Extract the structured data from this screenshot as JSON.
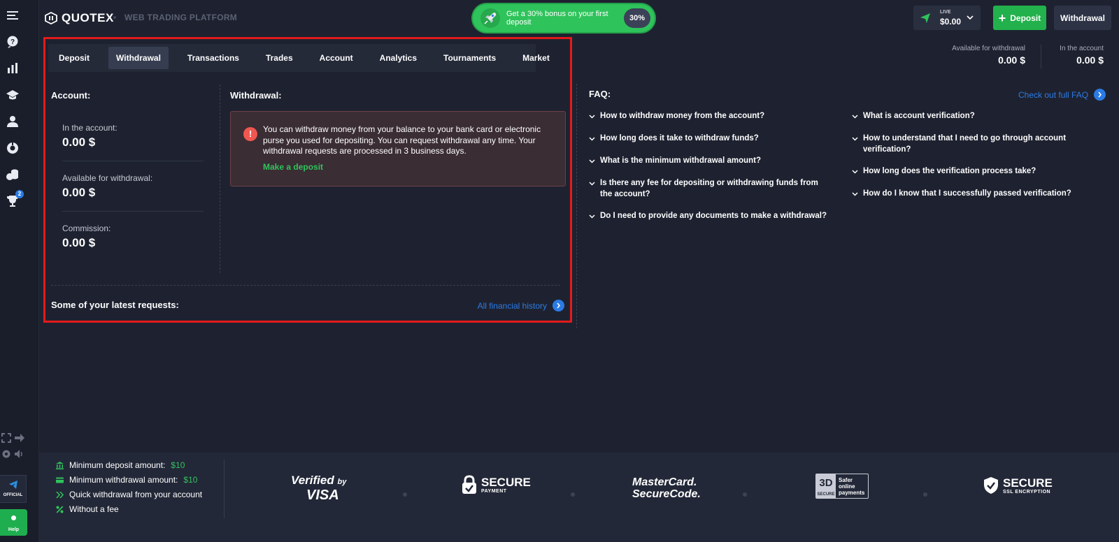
{
  "brand": {
    "name": "QUOTEX",
    "platform_label": "WEB TRADING PLATFORM"
  },
  "header": {
    "bonus_text": "Get a 30% bonus on your first deposit",
    "bonus_pct": "30%",
    "live_label": "LIVE",
    "live_value": "$0.00",
    "deposit_label": "Deposit",
    "withdrawal_label": "Withdrawal"
  },
  "sidebar": {
    "trophy_badge": "2",
    "official_label": "OFFICIAL",
    "help_label": "Help"
  },
  "top_stats": {
    "available_label": "Available for withdrawal",
    "available_value": "0.00 $",
    "account_label": "In the account",
    "account_value": "0.00 $"
  },
  "tabs": [
    {
      "label": "Deposit"
    },
    {
      "label": "Withdrawal",
      "active": true
    },
    {
      "label": "Transactions"
    },
    {
      "label": "Trades"
    },
    {
      "label": "Account"
    },
    {
      "label": "Analytics"
    },
    {
      "label": "Tournaments"
    },
    {
      "label": "Market"
    }
  ],
  "account": {
    "title": "Account:",
    "in_account_label": "In the account:",
    "in_account_value": "0.00 $",
    "available_label": "Available for withdrawal:",
    "available_value": "0.00 $",
    "commission_label": "Commission:",
    "commission_value": "0.00 $"
  },
  "withdrawal": {
    "title": "Withdrawal:",
    "alert_text": "You can withdraw money from your balance to your bank card or electronic purse you used for depositing. You can request withdrawal any time. Your withdrawal requests are processed in 3 business days.",
    "alert_link": "Make a deposit"
  },
  "requests": {
    "title": "Some of your latest requests:",
    "history_link": "All financial history"
  },
  "faq": {
    "title": "FAQ:",
    "full_link": "Check out full FAQ",
    "left": [
      "How to withdraw money from the account?",
      "How long does it take to withdraw funds?",
      "What is the minimum withdrawal amount?",
      "Is there any fee for depositing or withdrawing funds from the account?",
      "Do I need to provide any documents to make a withdrawal?"
    ],
    "right": [
      "What is account verification?",
      "How to understand that I need to go through account verification?",
      "How long does the verification process take?",
      "How do I know that I successfully passed verification?"
    ]
  },
  "footer": {
    "min_deposit_label": "Minimum deposit amount:",
    "min_deposit_value": "$10",
    "min_withdrawal_label": "Minimum withdrawal amount:",
    "min_withdrawal_value": "$10",
    "quick_withdrawal": "Quick withdrawal from your account",
    "no_fee": "Without a fee",
    "vbv_line1": "Verified",
    "vbv_by": "by",
    "vbv_line2": "VISA",
    "secure_title": "SECURE",
    "secure_sub": "PAYMENT",
    "mc_line1": "MasterCard.",
    "mc_line2": "SecureCode.",
    "td_big": "3D",
    "td_small": "SECURE",
    "td_text1": "Safer",
    "td_text2": "online",
    "td_text3": "payments",
    "ssl_title": "SECURE",
    "ssl_sub": "SSL ENCRYPTION"
  },
  "colors": {
    "accent_green": "#2fc35b",
    "link_blue": "#2b7be5",
    "highlight_red": "#e11b1b",
    "alert_red": "#f0574f",
    "background": "#1e2230"
  }
}
